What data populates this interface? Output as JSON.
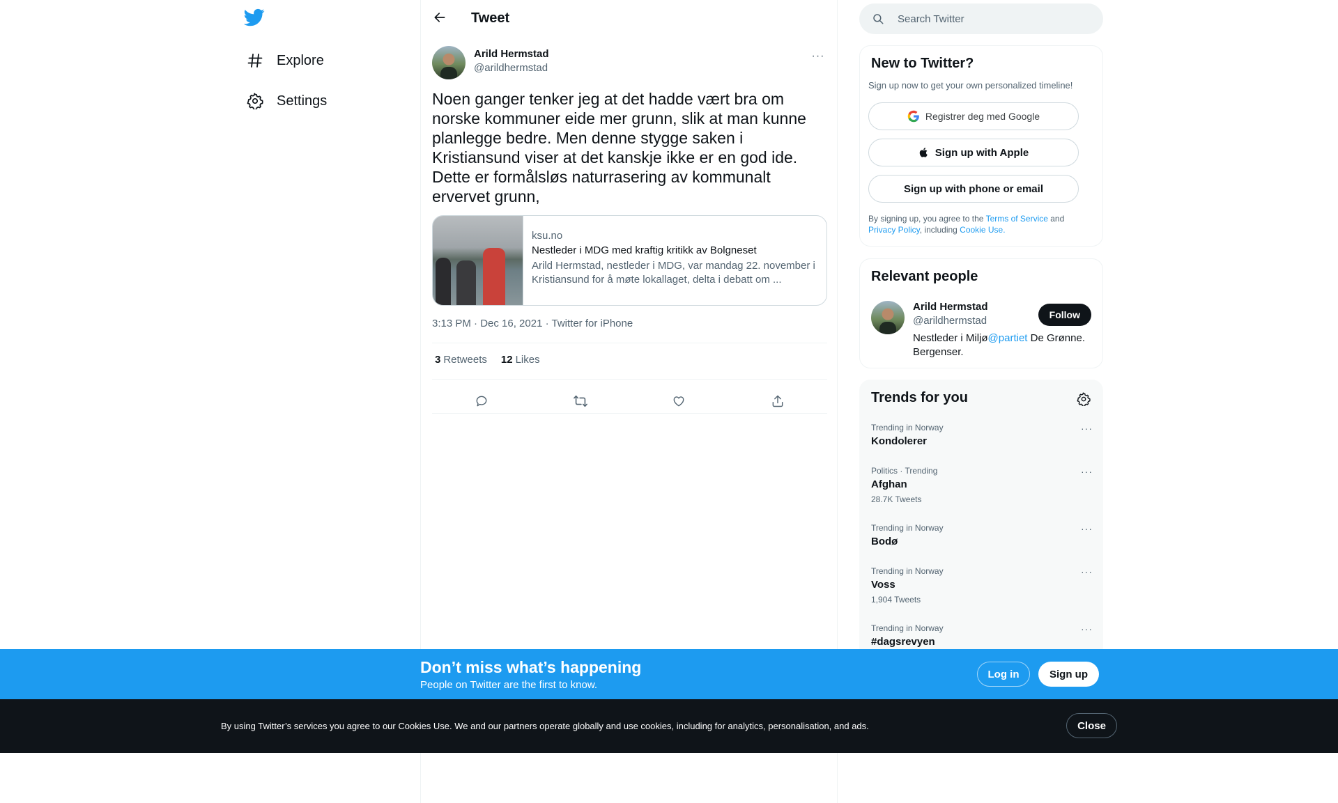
{
  "colors": {
    "accent": "#1d9bf0",
    "text": "#0f1419",
    "secondary": "#536471",
    "border": "#eff3f4"
  },
  "nav": {
    "logo_icon": "twitter-bird-icon",
    "items": [
      {
        "label": "Explore",
        "icon": "hashtag-icon"
      },
      {
        "label": "Settings",
        "icon": "gear-icon"
      }
    ]
  },
  "header": {
    "title": "Tweet",
    "back_icon": "arrow-left-icon"
  },
  "tweet": {
    "author_name": "Arild Hermstad",
    "author_handle": "@arildhermstad",
    "more": "···",
    "text": "Noen ganger tenker jeg at det hadde vært bra om norske kommuner eide mer grunn, slik at man kunne planlegge bedre. Men denne stygge saken i Kristiansund viser at det kanskje ikke er en god ide. Dette er formålsløs naturrasering av kommunalt ervervet grunn,",
    "card": {
      "domain": "ksu.no",
      "title": "Nestleder i MDG med kraftig kritikk av Bolgneset",
      "description": "Arild Hermstad, nestleder i MDG, var mandag 22. november i Kristiansund for å møte lokallaget, delta i debatt om ..."
    },
    "meta": "3:13 PM · Dec 16, 2021 · Twitter for iPhone",
    "retweets_count": "3",
    "retweets_label": "Retweets",
    "likes_count": "12",
    "likes_label": "Likes",
    "actions": [
      "reply-icon",
      "retweet-icon",
      "like-icon",
      "share-icon"
    ]
  },
  "search": {
    "placeholder": "Search Twitter"
  },
  "new_to_twitter": {
    "title": "New to Twitter?",
    "subtitle": "Sign up now to get your own personalized timeline!",
    "google_label": "Registrer deg med Google",
    "apple_label": "Sign up with Apple",
    "phone_label": "Sign up with phone or email",
    "legal_prefix": "By signing up, you agree to the ",
    "terms": "Terms of Service",
    "and": " and ",
    "privacy": "Privacy Policy",
    "including": ", including ",
    "cookie": "Cookie Use."
  },
  "relevant": {
    "title": "Relevant people",
    "name": "Arild Hermstad",
    "handle": "@arildhermstad",
    "bio_prefix": "Nestleder i Miljø",
    "bio_mention": "@partiet",
    "bio_suffix": " De Grønne. Bergenser.",
    "follow_label": "Follow"
  },
  "trends": {
    "title": "Trends for you",
    "items": [
      {
        "context": "Trending in Norway",
        "topic": "Kondolerer",
        "count": ""
      },
      {
        "context": "Politics · Trending",
        "topic": "Afghan",
        "count": "28.7K Tweets"
      },
      {
        "context": "Trending in Norway",
        "topic": "Bodø",
        "count": ""
      },
      {
        "context": "Trending in Norway",
        "topic": "Voss",
        "count": "1,904 Tweets"
      },
      {
        "context": "Trending in Norway",
        "topic": "#dagsrevyen",
        "count": ""
      }
    ]
  },
  "banner": {
    "title": "Don’t miss what’s happening",
    "subtitle": "People on Twitter are the first to know.",
    "login": "Log in",
    "signup": "Sign up"
  },
  "cookie_bar": {
    "text": "By using Twitter’s services you agree to our Cookies Use. We and our partners operate globally and use cookies, including for analytics, personalisation, and ads.",
    "close": "Close"
  }
}
